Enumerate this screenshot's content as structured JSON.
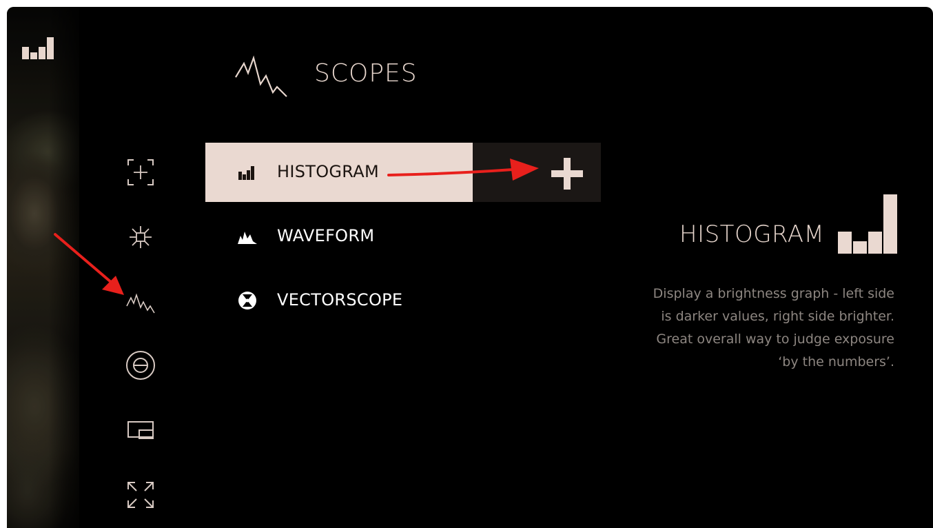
{
  "header": {
    "title": "SCOPES",
    "icon": "scopes-waveform-icon"
  },
  "sidebar": {
    "items": [
      {
        "name": "focus-assist-icon"
      },
      {
        "name": "exposure-icon"
      },
      {
        "name": "scopes-icon"
      },
      {
        "name": "false-color-icon"
      },
      {
        "name": "picture-in-picture-icon"
      },
      {
        "name": "fullscreen-icon"
      }
    ]
  },
  "menu": {
    "items": [
      {
        "label": "HISTOGRAM",
        "icon": "histogram-icon",
        "active": true
      },
      {
        "label": "WAVEFORM",
        "icon": "waveform-icon",
        "active": false
      },
      {
        "label": "VECTORSCOPE",
        "icon": "vectorscope-icon",
        "active": false
      }
    ],
    "add_icon": "plus-icon"
  },
  "detail": {
    "title": "HISTOGRAM",
    "icon": "histogram-large-icon",
    "description": "Display a brightness graph - left side is darker values, right side brighter. Great overall way to judge exposure ‘by the numbers’."
  },
  "colors": {
    "background": "#000000",
    "accent": "#ead9d1",
    "active_text": "#1b1410",
    "description_text": "#8d8681",
    "annotation_arrow": "#e8201c"
  }
}
